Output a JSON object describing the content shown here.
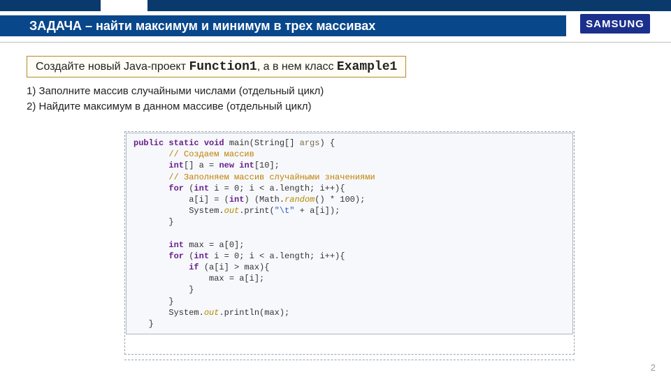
{
  "header": {
    "title": "ЗАДАЧА – найти максимум и минимум в трех массивах",
    "logo_text": "SAMSUNG"
  },
  "instruction": {
    "prefix": "Создайте новый Java-проект ",
    "project_name": "Function1",
    "middle": ", а в нем класс ",
    "class_name": "Example1"
  },
  "steps": {
    "s1": "1)  Заполните массив случайными числами (отдельный цикл)",
    "s2": "2)  Найдите максимум в данном массиве (отдельный цикл)"
  },
  "code": {
    "l01a": "public static void",
    "l01b": " main(String[] ",
    "l01c": "args",
    "l01d": ") {",
    "l02": "       // Создаем массив",
    "l03a": "       int",
    "l03b": "[] a = ",
    "l03c": "new int",
    "l03d": "[10];",
    "l04": "       // Заполняем массив случайными значениями",
    "l05a": "       for",
    "l05b": " (",
    "l05c": "int",
    "l05d": " i = 0; i < a.length; i++){",
    "l06a": "           a[i] = (",
    "l06b": "int",
    "l06c": ") (Math.",
    "l06d": "random",
    "l06e": "() * 100);",
    "l07a": "           System.",
    "l07b": "out",
    "l07c": ".print(",
    "l07d": "\"\\t\"",
    "l07e": " + a[i]);",
    "l08": "       }",
    "l09": "",
    "l10a": "       int",
    "l10b": " max = a[0];",
    "l11a": "       for",
    "l11b": " (",
    "l11c": "int",
    "l11d": " i = 0; i < a.length; i++){",
    "l12a": "           if",
    "l12b": " (a[i] > max){",
    "l13": "               max = a[i];",
    "l14": "           }",
    "l15": "       }",
    "l16a": "       System.",
    "l16b": "out",
    "l16c": ".println(max);",
    "l17": "   }"
  },
  "page_number": "2"
}
